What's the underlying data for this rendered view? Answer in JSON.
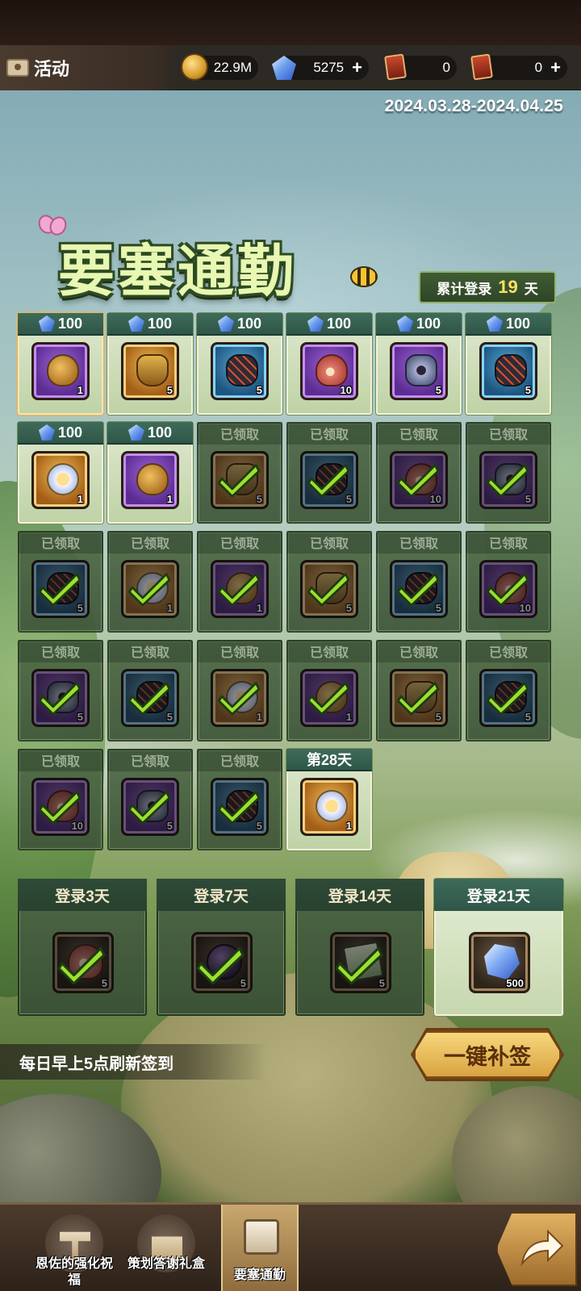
{
  "header": {
    "tab_title": "活动",
    "resources": [
      {
        "icon": "gold-coin-icon",
        "value": "22.9M",
        "plus": false
      },
      {
        "icon": "diamond-icon",
        "value": "5275",
        "plus": true
      },
      {
        "icon": "red-card-icon",
        "value": "0",
        "plus": false
      },
      {
        "icon": "ticket-icon",
        "value": "0",
        "plus": true
      }
    ]
  },
  "event": {
    "date_range": "2024.03.28-2024.04.25",
    "title": "要塞通勤",
    "cumulative_label": "累计登录",
    "cumulative_days": "19",
    "cumulative_unit": "天"
  },
  "days": [
    {
      "header": "100",
      "state": "available",
      "item": "gold-bag",
      "rarity": "purple",
      "count": "1"
    },
    {
      "header": "100",
      "state": "available",
      "item": "urn",
      "rarity": "gold",
      "count": "5"
    },
    {
      "header": "100",
      "state": "available",
      "item": "ore",
      "rarity": "blue",
      "count": "5"
    },
    {
      "header": "100",
      "state": "available",
      "item": "meat",
      "rarity": "purple",
      "count": "10"
    },
    {
      "header": "100",
      "state": "available",
      "item": "gear",
      "rarity": "purple",
      "count": "5"
    },
    {
      "header": "100",
      "state": "available",
      "item": "ore",
      "rarity": "blue",
      "count": "5"
    },
    {
      "header": "100",
      "state": "available",
      "item": "wing-emblem",
      "rarity": "gold",
      "count": "1"
    },
    {
      "header": "100",
      "state": "available",
      "item": "gold-bag",
      "rarity": "purple",
      "count": "1"
    },
    {
      "header": "已领取",
      "state": "claimed",
      "item": "urn",
      "rarity": "gold",
      "count": "5"
    },
    {
      "header": "已领取",
      "state": "claimed",
      "item": "ore",
      "rarity": "blue",
      "count": "5"
    },
    {
      "header": "已领取",
      "state": "claimed",
      "item": "meat",
      "rarity": "purple",
      "count": "10"
    },
    {
      "header": "已领取",
      "state": "claimed",
      "item": "gear",
      "rarity": "purple",
      "count": "5"
    },
    {
      "header": "已领取",
      "state": "claimed",
      "item": "ore",
      "rarity": "blue",
      "count": "5"
    },
    {
      "header": "已领取",
      "state": "claimed",
      "item": "wing-emblem",
      "rarity": "gold",
      "count": "1"
    },
    {
      "header": "已领取",
      "state": "claimed",
      "item": "gold-bag",
      "rarity": "purple",
      "count": "1"
    },
    {
      "header": "已领取",
      "state": "claimed",
      "item": "urn",
      "rarity": "gold",
      "count": "5"
    },
    {
      "header": "已领取",
      "state": "claimed",
      "item": "ore",
      "rarity": "blue",
      "count": "5"
    },
    {
      "header": "已领取",
      "state": "claimed",
      "item": "meat",
      "rarity": "purple",
      "count": "10"
    },
    {
      "header": "已领取",
      "state": "claimed",
      "item": "gear",
      "rarity": "purple",
      "count": "5"
    },
    {
      "header": "已领取",
      "state": "claimed",
      "item": "ore",
      "rarity": "blue",
      "count": "5"
    },
    {
      "header": "已领取",
      "state": "claimed",
      "item": "wing-emblem",
      "rarity": "gold",
      "count": "1"
    },
    {
      "header": "已领取",
      "state": "claimed",
      "item": "gold-bag",
      "rarity": "purple",
      "count": "1"
    },
    {
      "header": "已领取",
      "state": "claimed",
      "item": "urn",
      "rarity": "gold",
      "count": "5"
    },
    {
      "header": "已领取",
      "state": "claimed",
      "item": "ore",
      "rarity": "blue",
      "count": "5"
    },
    {
      "header": "已领取",
      "state": "claimed",
      "item": "meat",
      "rarity": "purple",
      "count": "10"
    },
    {
      "header": "已领取",
      "state": "claimed",
      "item": "gear",
      "rarity": "purple",
      "count": "5"
    },
    {
      "header": "已领取",
      "state": "claimed",
      "item": "ore",
      "rarity": "blue",
      "count": "5"
    },
    {
      "header": "第28天",
      "state": "available",
      "item": "wing-emblem",
      "rarity": "gold",
      "count": "1"
    }
  ],
  "milestones": [
    {
      "label": "登录3天",
      "state": "claimed",
      "item": "meat",
      "count": "5"
    },
    {
      "label": "登录7天",
      "state": "claimed",
      "item": "bomb",
      "count": "5"
    },
    {
      "label": "登录14天",
      "state": "claimed",
      "item": "book",
      "count": "5"
    },
    {
      "label": "登录21天",
      "state": "available",
      "item": "crystal",
      "count": "500"
    }
  ],
  "notice": "每日早上5点刷新签到",
  "resign_button": "一键补签",
  "bottom_nav": [
    {
      "label": "恩佐的强化祝福",
      "icon": "hammer-icon",
      "active": false
    },
    {
      "label": "策划答谢礼盒",
      "icon": "gift-box-icon",
      "active": false
    },
    {
      "label": "要塞通勤",
      "icon": "calendar-icon",
      "active": true
    }
  ]
}
